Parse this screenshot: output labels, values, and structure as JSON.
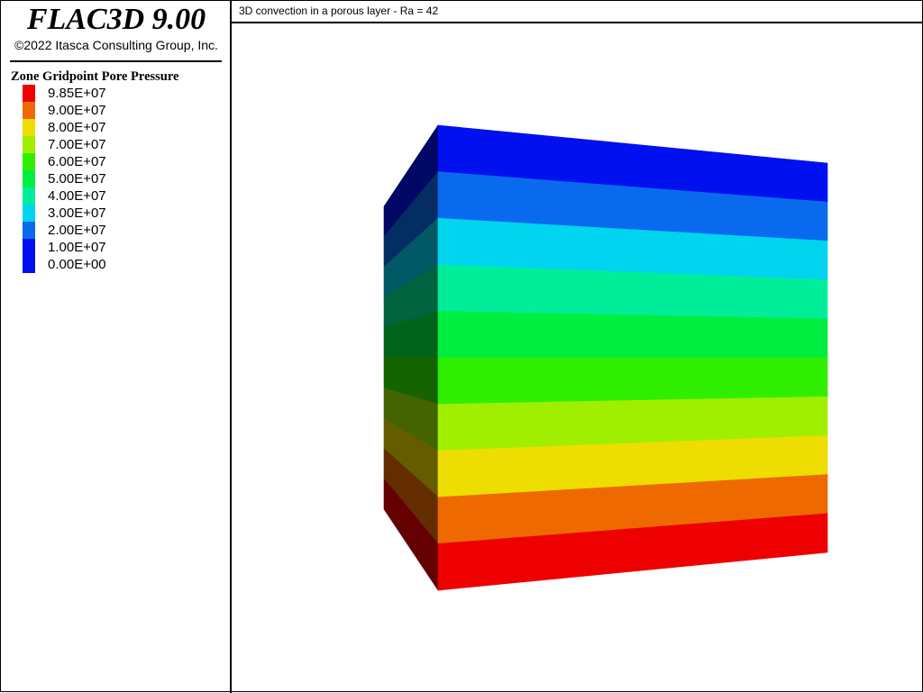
{
  "header": {
    "app_title": "FLAC3D 9.00",
    "copyright": "©2022 Itasca Consulting Group, Inc."
  },
  "legend": {
    "title": "Zone Gridpoint Pore Pressure",
    "items": [
      {
        "label": "9.85E+07",
        "color": "#ee0000"
      },
      {
        "label": "9.00E+07",
        "color": "#ee6a00"
      },
      {
        "label": "8.00E+07",
        "color": "#eedd00"
      },
      {
        "label": "7.00E+07",
        "color": "#a0ee00"
      },
      {
        "label": "6.00E+07",
        "color": "#30ee00"
      },
      {
        "label": "5.00E+07",
        "color": "#00ee40"
      },
      {
        "label": "4.00E+07",
        "color": "#00ee9a"
      },
      {
        "label": "3.00E+07",
        "color": "#00d4ee"
      },
      {
        "label": "2.00E+07",
        "color": "#0a6aee"
      },
      {
        "label": "1.00E+07",
        "color": "#0010ee"
      },
      {
        "label": "0.00E+00",
        "color": "#0010ee"
      }
    ]
  },
  "plot": {
    "title": "3D convection in a porous layer - Ra = 42"
  },
  "model_view": {
    "band_colors_top_to_bottom": [
      "#0010ee",
      "#0a6aee",
      "#00d4ee",
      "#00ee9a",
      "#00ee40",
      "#30ee00",
      "#a0ee00",
      "#eedd00",
      "#ee6a00",
      "#ee0000"
    ],
    "side_shade_factor": 0.42
  }
}
